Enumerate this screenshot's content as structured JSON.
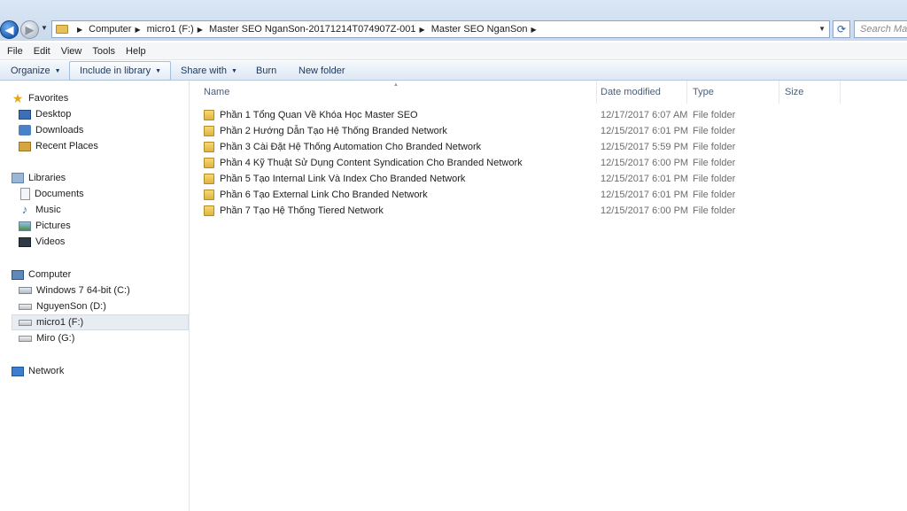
{
  "address": {
    "crumbs": [
      "Computer",
      "micro1 (F:)",
      "Master SEO NganSon-20171214T074907Z-001",
      "Master SEO NganSon"
    ],
    "search_placeholder": "Search Mas"
  },
  "menu": [
    "File",
    "Edit",
    "View",
    "Tools",
    "Help"
  ],
  "toolbar": {
    "organize": "Organize",
    "include": "Include in library",
    "share": "Share with",
    "burn": "Burn",
    "new_folder": "New folder"
  },
  "nav": {
    "favorites": {
      "label": "Favorites",
      "items": [
        "Desktop",
        "Downloads",
        "Recent Places"
      ]
    },
    "libraries": {
      "label": "Libraries",
      "items": [
        "Documents",
        "Music",
        "Pictures",
        "Videos"
      ]
    },
    "computer": {
      "label": "Computer",
      "items": [
        "Windows 7 64-bit (C:)",
        "NguyenSon (D:)",
        "micro1 (F:)",
        "Miro (G:)"
      ]
    },
    "network": {
      "label": "Network"
    }
  },
  "columns": {
    "name": "Name",
    "date": "Date modified",
    "type": "Type",
    "size": "Size"
  },
  "files": [
    {
      "name": "Phần 1 Tổng Quan Về Khóa Học Master SEO",
      "date": "12/17/2017 6:07 AM",
      "type": "File folder"
    },
    {
      "name": "Phần 2 Hướng Dẫn Tạo Hệ Thống Branded Network",
      "date": "12/15/2017 6:01 PM",
      "type": "File folder"
    },
    {
      "name": "Phần 3 Cài Đặt Hệ Thống Automation Cho Branded Network",
      "date": "12/15/2017 5:59 PM",
      "type": "File folder"
    },
    {
      "name": "Phần 4 Kỹ Thuật Sử Dụng Content Syndication Cho Branded Network",
      "date": "12/15/2017 6:00 PM",
      "type": "File folder"
    },
    {
      "name": "Phần 5 Tạo Internal Link Và Index Cho Branded Network",
      "date": "12/15/2017 6:01 PM",
      "type": "File folder"
    },
    {
      "name": "Phần 6 Tạo External Link Cho Branded Network",
      "date": "12/15/2017 6:01 PM",
      "type": "File folder"
    },
    {
      "name": "Phần 7 Tạo Hệ Thống Tiered Network",
      "date": "12/15/2017 6:00 PM",
      "type": "File folder"
    }
  ]
}
